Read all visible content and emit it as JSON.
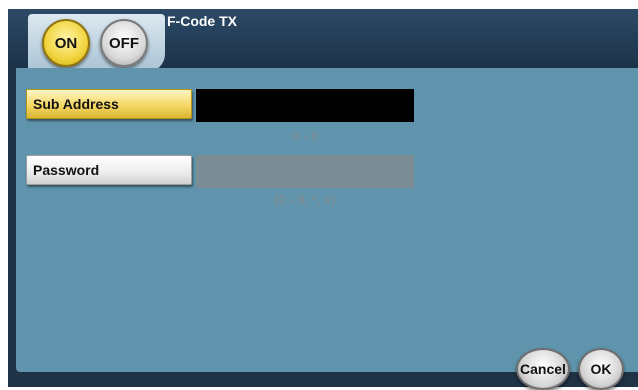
{
  "header": {
    "title": "F-Code TX",
    "toggle": {
      "on_label": "ON",
      "off_label": "OFF",
      "selected": "ON"
    }
  },
  "fields": {
    "sub_address": {
      "label": "Sub Address",
      "value": "",
      "range": "0 - 9",
      "active": true
    },
    "password": {
      "label": "Password",
      "value": "",
      "range": "(0 - 9, *, #)",
      "active": false
    }
  },
  "footer": {
    "cancel_label": "Cancel",
    "ok_label": "OK"
  },
  "colors": {
    "accent": "#f1d43e",
    "background": "#5f94ac",
    "header": "#1f3246"
  }
}
